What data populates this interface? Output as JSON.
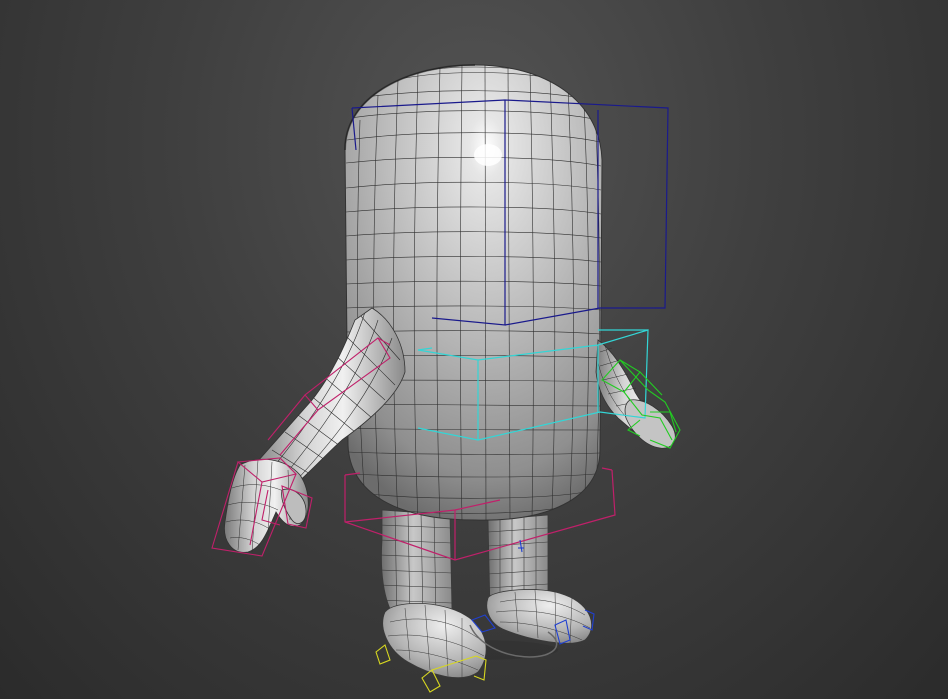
{
  "viewport": {
    "background_top": "#535353",
    "background_bottom": "#2b2b2b",
    "mesh_fill": "#b8b8b8",
    "wire_color": "#2e2e2e"
  },
  "scene": {
    "model": "cartoon-character-mesh",
    "rig_controls": [
      {
        "name": "head-control",
        "color": "#1a1a8c"
      },
      {
        "name": "torso-control",
        "color": "#33d6d6"
      },
      {
        "name": "pelvis-control",
        "color": "#c0206a"
      },
      {
        "name": "arm-left-control",
        "color": "#c0206a"
      },
      {
        "name": "hand-left-control",
        "color": "#c0206a"
      },
      {
        "name": "arm-right-control",
        "color": "#22cc22"
      },
      {
        "name": "foot-left-control",
        "color": "#d8d820"
      },
      {
        "name": "foot-right-control",
        "color": "#2040d0"
      }
    ]
  }
}
